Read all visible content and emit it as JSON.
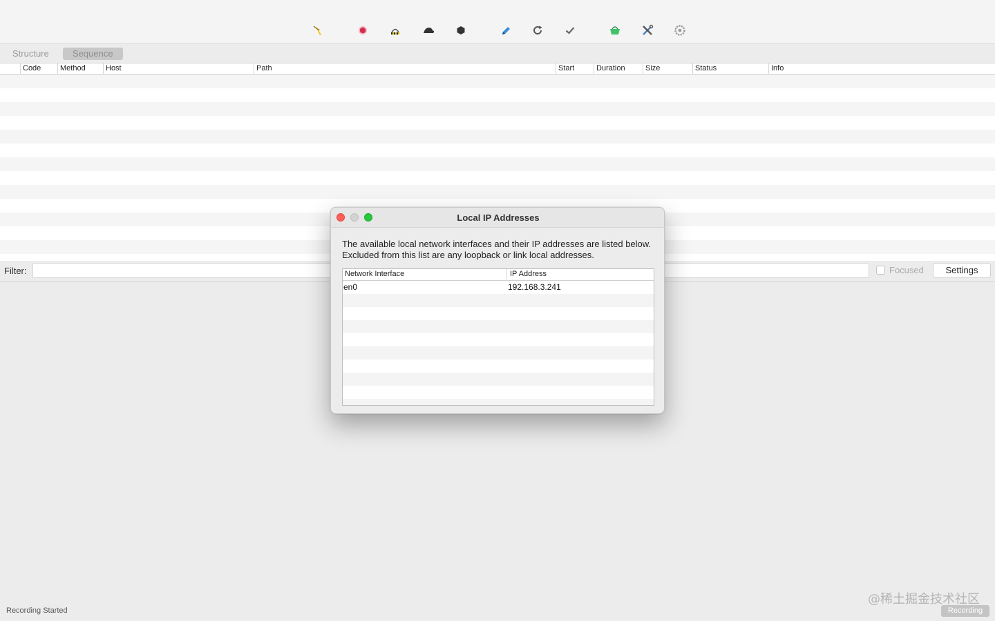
{
  "toolbar": {
    "icons": [
      "broom-icon",
      "record-icon",
      "throttle-icon",
      "turtle-icon",
      "hexagon-icon",
      "pen-icon",
      "refresh-icon",
      "check-icon",
      "basket-icon",
      "tools-icon",
      "gear-icon"
    ]
  },
  "tabs": [
    {
      "label": "Structure",
      "selected": false
    },
    {
      "label": "Sequence",
      "selected": true
    }
  ],
  "table": {
    "columns": [
      "Code",
      "Method",
      "Host",
      "Path",
      "Start",
      "Duration",
      "Size",
      "Status",
      "Info"
    ],
    "rows": []
  },
  "filter": {
    "label": "Filter:",
    "value": "",
    "focused_label": "Focused",
    "focused_checked": false,
    "settings_label": "Settings"
  },
  "status": {
    "left_text": "Recording Started",
    "badge": "Recording"
  },
  "watermark": "@稀土掘金技术社区",
  "dialog": {
    "title": "Local IP Addresses",
    "description": "The available local network interfaces and their IP addresses are listed below.  Excluded from this list are any loopback or link local addresses.",
    "columns": [
      "Network Interface",
      "IP Address"
    ],
    "rows": [
      {
        "interface": "en0",
        "ip": "192.168.3.241"
      }
    ]
  }
}
